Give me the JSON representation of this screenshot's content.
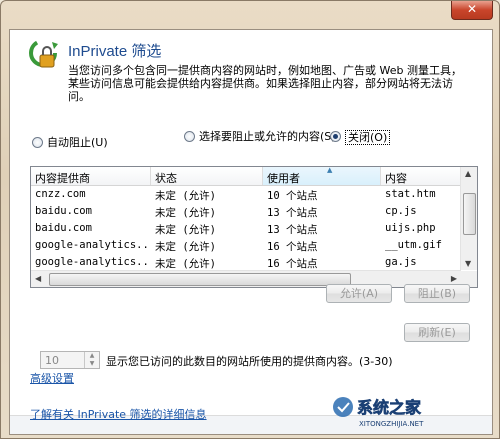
{
  "window": {
    "close_label": "✕"
  },
  "header": {
    "icon": "inprivate-filter-icon",
    "title": "InPrivate 筛选",
    "description": "当您访问多个包含同一提供商内容的网站时，例如地图、广告或 Web 测量工具，某些访问信息可能会提供给内容提供商。如果选择阻止内容，部分网站将无法访问。"
  },
  "options": {
    "auto_block": "自动阻止(U)",
    "choose_content": "选择要阻止或允许的内容(S)",
    "off": "关闭(O)",
    "selected": "off"
  },
  "table": {
    "columns": [
      "内容提供商",
      "状态",
      "使用者",
      "内容"
    ],
    "sorted_column": "使用者",
    "rows": [
      {
        "provider": "cnzz.com",
        "status": "未定 (允许)",
        "used_by": "10 个站点",
        "content": "stat.htm"
      },
      {
        "provider": "baidu.com",
        "status": "未定 (允许)",
        "used_by": "13 个站点",
        "content": "cp.js"
      },
      {
        "provider": "baidu.com",
        "status": "未定 (允许)",
        "used_by": "13 个站点",
        "content": "uijs.php"
      },
      {
        "provider": "google-analytics...",
        "status": "未定 (允许)",
        "used_by": "16 个站点",
        "content": "__utm.gif"
      },
      {
        "provider": "google-analytics...",
        "status": "未定 (允许)",
        "used_by": "16 个站点",
        "content": "ga.js"
      }
    ]
  },
  "buttons": {
    "allow": "允许(A)",
    "block": "阻止(B)",
    "refresh": "刷新(E)"
  },
  "threshold": {
    "value": "10",
    "label": "显示您已访问的此数目的网站所使用的提供商内容。(3-30)"
  },
  "links": {
    "advanced": "高级设置",
    "learn_more": "了解有关 InPrivate 筛选的详细信息"
  },
  "watermark": {
    "text": "系统之家",
    "url": "XITONGZHIJIA.NET"
  }
}
